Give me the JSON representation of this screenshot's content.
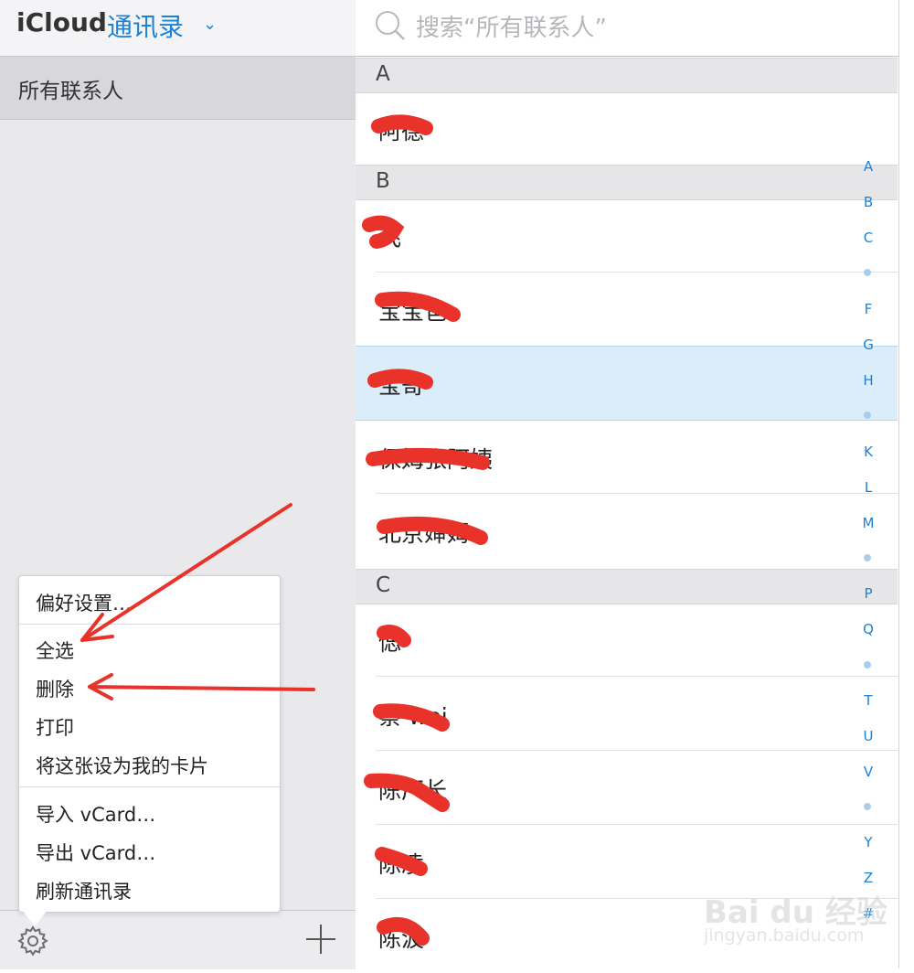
{
  "header": {
    "app": "iCloud",
    "section": "通讯录",
    "chevron": "⌄"
  },
  "sidebar": {
    "group": "所有联系人"
  },
  "search": {
    "placeholder": "搜索“所有联系人”"
  },
  "menu": {
    "items": [
      "偏好设置…",
      "全选",
      "删除",
      "打印",
      "将这张设为我的卡片",
      "导入 vCard…",
      "导出 vCard…",
      "刷新通讯录"
    ]
  },
  "sections": {
    "a": "A",
    "b": "B",
    "c": "C"
  },
  "contacts": {
    "a1": "阿德",
    "b1": "飞",
    "b2": "宝宝爸",
    "b3": "宝哥",
    "b4": "保姆张阿姨",
    "b5": "北京婶姆",
    "c1": "偲",
    "c2": "蔡 wei",
    "c3": "陈厂长",
    "c4": "陈凌",
    "c5": "陈波"
  },
  "index": [
    "A",
    "B",
    "C",
    "•",
    "F",
    "G",
    "H",
    "•",
    "K",
    "L",
    "M",
    "•",
    "P",
    "Q",
    "•",
    "T",
    "U",
    "V",
    "•",
    "Y",
    "Z",
    "#"
  ],
  "watermark": {
    "brand": "Bai du 经验",
    "url": "jingyan.baidu.com"
  },
  "colors": {
    "accent": "#1a82d8",
    "selected_row": "#daedf8",
    "annotation": "#e8322a"
  }
}
